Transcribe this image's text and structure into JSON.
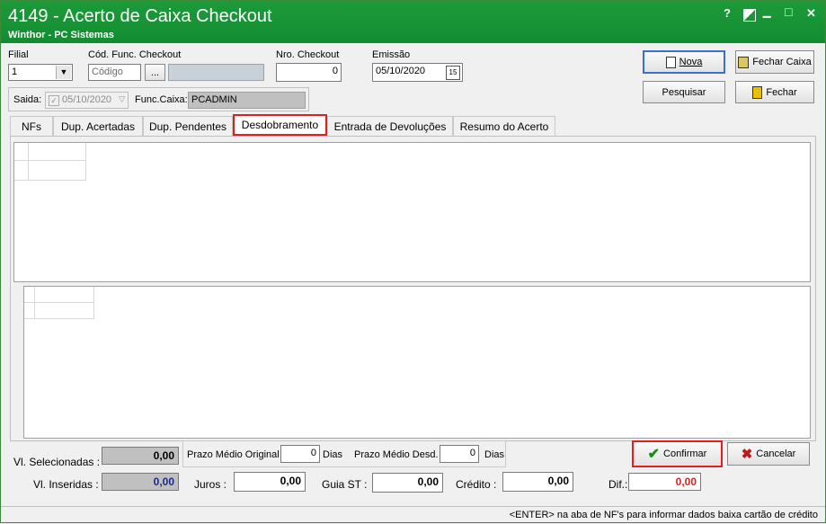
{
  "window": {
    "title": "4149 - Acerto de Caixa Checkout",
    "subtitle": "Winthor - PC Sistemas",
    "help_glyph": "?",
    "min_glyph": "▁",
    "max_glyph": "□",
    "close_glyph": "✕"
  },
  "header": {
    "filial_label": "Filial",
    "filial_value": "1",
    "cod_func_label": "Cód. Func. Checkout",
    "cod_func_placeholder": "Código",
    "ellipsis_label": "...",
    "nro_checkout_label": "Nro. Checkout",
    "nro_checkout_value": "0",
    "emissao_label": "Emissão",
    "emissao_value": "05/10/2020",
    "calendar_glyph": "15",
    "saida_label": "Saida:",
    "saida_value": "05/10/2020",
    "func_caixa_label": "Func.Caixa:",
    "func_caixa_value": "PCADMIN"
  },
  "actions": {
    "nova_label": "Nova",
    "fechar_caixa_label": "Fechar Caixa",
    "pesquisar_label": "Pesquisar",
    "fechar_label": "Fechar"
  },
  "tabs": [
    {
      "label": "NFs"
    },
    {
      "label": "Dup. Acertadas"
    },
    {
      "label": "Dup. Pendentes"
    },
    {
      "label": "Desdobramento"
    },
    {
      "label": "Entrada de Devoluções"
    },
    {
      "label": "Resumo do Acerto"
    }
  ],
  "totals": {
    "vl_selecionadas_label": "Vl. Selecionadas :",
    "vl_selecionadas_value": "0,00",
    "vl_inseridas_label": "Vl. Inseridas :",
    "vl_inseridas_value": "0,00",
    "prazo_original_label": "Prazo Médio Original",
    "prazo_original_value": "0",
    "dias_label_1": "Dias",
    "prazo_desd_label": "Prazo Médio Desd.",
    "prazo_desd_value": "0",
    "dias_label_2": "Dias",
    "juros_label": "Juros :",
    "juros_value": "0,00",
    "guia_st_label": "Guia ST :",
    "guia_st_value": "0,00",
    "credito_label": "Crédito :",
    "credito_value": "0,00",
    "dif_label": "Dif.:",
    "dif_value": "0,00"
  },
  "bottom_actions": {
    "confirmar_label": "Confirmar",
    "cancelar_label": "Cancelar"
  },
  "status": {
    "hint": "<ENTER> na aba de NF's para informar dados baixa cartão de crédito"
  },
  "colors": {
    "title_bg": "#1c9b3a",
    "dif_color": "#e02020",
    "vl_inseridas_color": "#1a2a8a",
    "highlight": "#e02020"
  }
}
